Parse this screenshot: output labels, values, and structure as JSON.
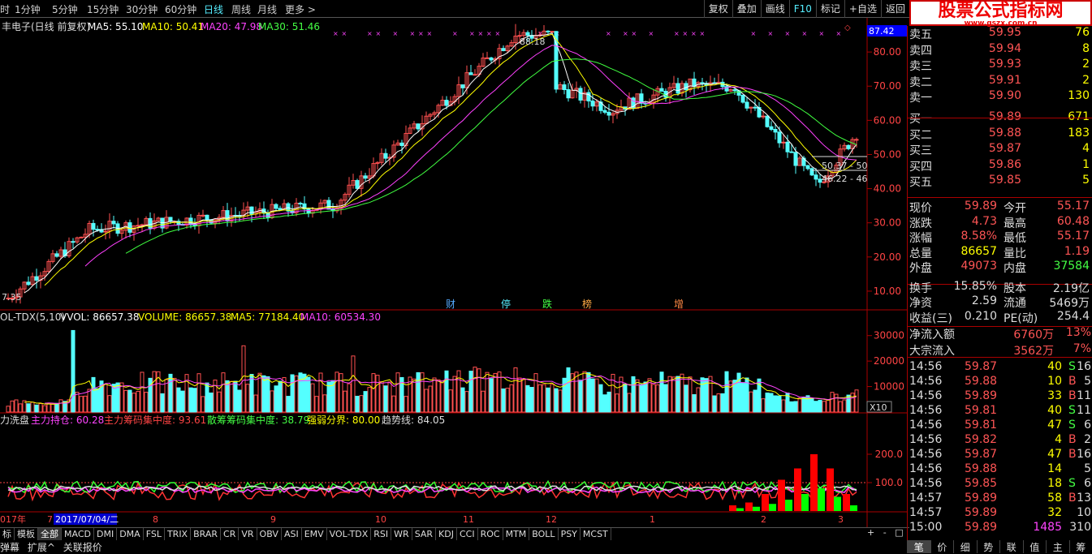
{
  "toolbar": {
    "tf": [
      "时",
      "1分钟",
      "5分钟",
      "15分钟",
      "30分钟",
      "60分钟",
      "日线",
      "周线",
      "月线",
      "更多 >"
    ],
    "selected": "日线",
    "buttons": [
      "复权",
      "叠加",
      "画线",
      "F10",
      "标记",
      "+自选",
      "返回"
    ]
  },
  "logo": {
    "line1": "股票公式指标网",
    "line2": "www.gszx.com.cn"
  },
  "price_header": {
    "name": "丰电子(日线 前复权)",
    "ma5": "MA5: 55.10",
    "ma10": "MA10: 50.41",
    "ma20": "MA20: 47.98",
    "ma30": "MA30: 51.46"
  },
  "price_axis": [
    "80.00",
    "70.00",
    "60.00",
    "50.00",
    "40.00",
    "30.00",
    "20.00",
    "10.00"
  ],
  "price_axis_top": "87.42",
  "annotations": {
    "high": "88.18",
    "low": "7.35",
    "a1": "50.37 - 50",
    "a2": "46.22 - 46"
  },
  "events": [
    "财",
    "停",
    "跌",
    "榜",
    "增"
  ],
  "vol_header": {
    "name": "OL-TDX(5,10)",
    "vvol": "VVOL: 86657.38",
    "volume": "VOLUME: 86657.38",
    "ma5": "MA5: 77184.40",
    "ma10": "MA10: 60534.30"
  },
  "vol_axis": [
    "30000",
    "20000",
    "10000"
  ],
  "vol_unit": "X10",
  "ind_header": {
    "name": "力洗盘",
    "a": "主力持仓: 60.28",
    "b": "主力筹码集中度: 93.61",
    "c": "散筹筹码集中度: 38.79",
    "d": "强弱分界: 80.00",
    "e": "趋势线: 84.05"
  },
  "ind_axis": [
    "200.0",
    "100.0"
  ],
  "date_axis": {
    "year": "017年",
    "first": "7",
    "cursor_date": "2017/07/04/二",
    "months": [
      "8",
      "9",
      "10",
      "11",
      "12",
      "1",
      "2",
      "3"
    ]
  },
  "tabs": [
    "标",
    "模板",
    "全部",
    "MACD",
    "DMI",
    "DMA",
    "FSL",
    "TRIX",
    "BRAR",
    "CR",
    "VR",
    "OBV",
    "ASI",
    "EMV",
    "VOL-TDX",
    "RSI",
    "WR",
    "SAR",
    "KDJ",
    "CCI",
    "ROC",
    "MTM",
    "BOLL",
    "PSY",
    "MCST"
  ],
  "tabs_selected": "全部",
  "zoom_btns": [
    "+",
    "-",
    "□"
  ],
  "bottom_links": [
    "弹幕",
    "扩展^",
    "关联报价"
  ],
  "order_book": [
    {
      "label": "卖五",
      "price": "59.95",
      "vol": "76"
    },
    {
      "label": "卖四",
      "price": "59.94",
      "vol": "8"
    },
    {
      "label": "卖三",
      "price": "59.93",
      "vol": "2"
    },
    {
      "label": "卖二",
      "price": "59.91",
      "vol": "2"
    },
    {
      "label": "卖一",
      "price": "59.90",
      "vol": "130"
    },
    {
      "label": "买一",
      "price": "59.89",
      "vol": "671"
    },
    {
      "label": "买二",
      "price": "59.88",
      "vol": "183"
    },
    {
      "label": "买三",
      "price": "59.87",
      "vol": "4"
    },
    {
      "label": "买四",
      "price": "59.86",
      "vol": "1"
    },
    {
      "label": "买五",
      "price": "59.85",
      "vol": "5"
    }
  ],
  "stats": [
    {
      "l": "现价",
      "v": "59.89",
      "l2": "今开",
      "v2": "55.17"
    },
    {
      "l": "涨跌",
      "v": "4.73",
      "l2": "最高",
      "v2": "60.48"
    },
    {
      "l": "涨幅",
      "v": "8.58%",
      "l2": "最低",
      "v2": "55.17"
    },
    {
      "l": "总量",
      "v": "86657",
      "l2": "量比",
      "v2": "1.19"
    },
    {
      "l": "外盘",
      "v": "49073",
      "l2": "内盘",
      "v2": "37584"
    },
    {
      "l": "换手",
      "v": "15.85%",
      "l2": "股本",
      "v2": "2.19亿"
    },
    {
      "l": "净资",
      "v": "2.59",
      "l2": "流通",
      "v2": "5469万"
    },
    {
      "l": "收益(三)",
      "v": "0.210",
      "l2": "PE(动)",
      "v2": "254.4"
    }
  ],
  "flows": [
    {
      "l": "净流入额",
      "v": "6760万",
      "p": "13%"
    },
    {
      "l": "大宗流入",
      "v": "3562万",
      "p": "7%"
    }
  ],
  "ticks": [
    {
      "t": "14:56",
      "p": "59.87",
      "v": "40",
      "s": "S",
      "n": "16"
    },
    {
      "t": "14:56",
      "p": "59.88",
      "v": "10",
      "s": "B",
      "n": "5"
    },
    {
      "t": "14:56",
      "p": "59.89",
      "v": "33",
      "s": "B",
      "n": "11"
    },
    {
      "t": "14:56",
      "p": "59.81",
      "v": "40",
      "s": "S",
      "n": "11"
    },
    {
      "t": "14:56",
      "p": "59.81",
      "v": "47",
      "s": "S",
      "n": "6"
    },
    {
      "t": "14:56",
      "p": "59.82",
      "v": "4",
      "s": "B",
      "n": "2"
    },
    {
      "t": "14:56",
      "p": "59.87",
      "v": "47",
      "s": "B",
      "n": "16"
    },
    {
      "t": "14:56",
      "p": "59.88",
      "v": "14",
      "s": "",
      "n": "5"
    },
    {
      "t": "14:56",
      "p": "59.85",
      "v": "18",
      "s": "S",
      "n": "6"
    },
    {
      "t": "14:57",
      "p": "59.89",
      "v": "58",
      "s": "B",
      "n": "13"
    },
    {
      "t": "14:57",
      "p": "59.89",
      "v": "32",
      "s": "",
      "n": "10"
    },
    {
      "t": "15:00",
      "p": "59.89",
      "v": "1485",
      "s": "",
      "n": "310"
    }
  ],
  "qtabs": [
    "笔",
    "价",
    "细",
    "势",
    "联",
    "值",
    "主",
    "筹"
  ],
  "chart_data": {
    "type": "candlestick",
    "xlabel": "",
    "ylabel": "",
    "price_ylim": [
      5,
      90
    ],
    "vol_ylim": [
      0,
      35000
    ],
    "ind_ylim": [
      0,
      300
    ],
    "price_series": [
      {
        "name": "MA5"
      },
      {
        "name": "MA10"
      },
      {
        "name": "MA20"
      },
      {
        "name": "MA30"
      }
    ],
    "colors": {
      "up": "#ff5050",
      "down": "#54ffff",
      "ma5": "#ffffff",
      "ma10": "#ffff00",
      "ma20": "#ff40ff",
      "ma30": "#40ff40"
    }
  }
}
